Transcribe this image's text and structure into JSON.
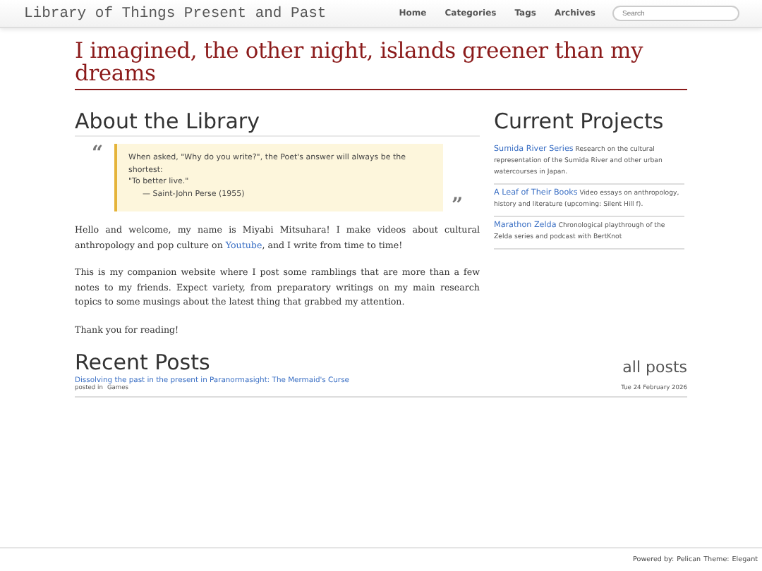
{
  "navbar": {
    "brand": "Library of Things Present and Past",
    "links": [
      "Home",
      "Categories",
      "Tags",
      "Archives"
    ],
    "search": {
      "placeholder": "Search"
    }
  },
  "headline": "I imagined, the other night, islands greener than my dreams",
  "about": {
    "title": "About the Library",
    "quote": {
      "open_mark": "“",
      "close_mark": "”",
      "lines": [
        "When asked, \"Why do you write?\", the Poet's answer will always be the shortest:",
        "\"To better live.\""
      ],
      "attribution": "— Saint-John Perse (1955)"
    },
    "paragraphs": [
      {
        "before": "Hello and welcome, my name is Miyabi Mitsuhara! I make videos about cultural anthropology and pop culture on ",
        "link": "Youtube",
        "after": ", and I write from time to time!"
      },
      {
        "before": "This is my companion website where I post some ramblings that are more than a few notes to my friends. Expect variety, from preparatory writings on my main research topics to some musings about the latest thing that grabbed my attention."
      },
      {
        "before": "Thank you for reading!"
      }
    ]
  },
  "projects": {
    "title": "Current Projects",
    "items": [
      {
        "name": "Sumida River Series",
        "description": "Research on the cultural representation of the Sumida River and other urban watercourses in Japan."
      },
      {
        "name": "A Leaf of Their Books",
        "description": "Video essays on anthropology, history and literature (upcoming: Silent Hill f)."
      },
      {
        "name": "Marathon Zelda",
        "description": "Chronological playthrough of the Zelda series and podcast with BertKnot"
      }
    ]
  },
  "recent_posts": {
    "title": "Recent Posts",
    "all_link": "all posts",
    "posts": [
      {
        "title": "Dissolving the past in the present in Paranormasight: The Mermaid's Curse",
        "posted_in_label": "posted in",
        "category": "Games",
        "date": "Tue 24 February 2026"
      }
    ]
  },
  "footer": {
    "powered_label": "Powered by:",
    "engine": "Pelican",
    "theme_label": "Theme:",
    "theme": "Elegant"
  }
}
